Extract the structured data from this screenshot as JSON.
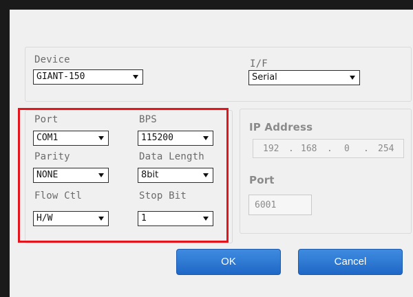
{
  "device": {
    "label": "Device",
    "value": "GIANT-150"
  },
  "interface": {
    "label": "I/F",
    "value": "Serial"
  },
  "serial": {
    "port": {
      "label": "Port",
      "value": "COM1"
    },
    "bps": {
      "label": "BPS",
      "value": "115200"
    },
    "parity": {
      "label": "Parity",
      "value": "NONE"
    },
    "data_length": {
      "label": "Data Length",
      "value": "8bit"
    },
    "flow_ctl": {
      "label": "Flow Ctl",
      "value": "H/W"
    },
    "stop_bit": {
      "label": "Stop Bit",
      "value": "1"
    }
  },
  "network": {
    "ip_label": "IP Address",
    "ip": {
      "o1": "192",
      "o2": "168",
      "o3": "0",
      "o4": "254",
      "dot": "."
    },
    "port_label": "Port",
    "port_value": "6001"
  },
  "buttons": {
    "ok": "OK",
    "cancel": "Cancel"
  },
  "colors": {
    "highlight": "#e3141b",
    "button": "#2a78d6"
  }
}
